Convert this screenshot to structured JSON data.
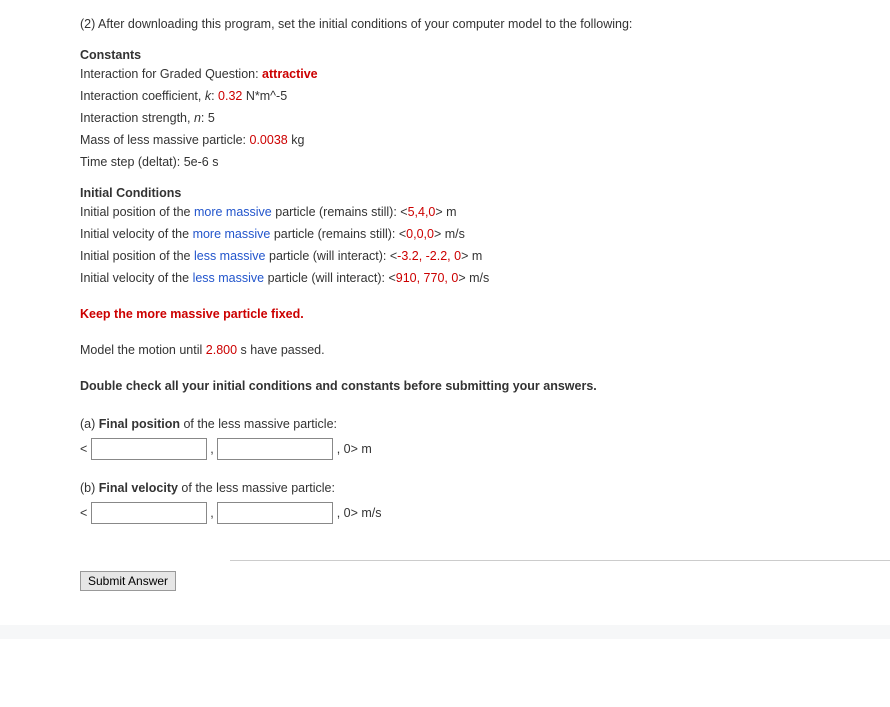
{
  "intro": "(2) After downloading this program, set the initial conditions of your computer model to the following:",
  "constants": {
    "heading": "Constants",
    "interaction_label": "Interaction for Graded Question: ",
    "interaction_value": "attractive",
    "coeff_label_pre": "Interaction coefficient, ",
    "coeff_symbol": "k",
    "coeff_label_colon": ": ",
    "coeff_value": "0.32",
    "coeff_unit": " N*m^-5",
    "strength_label_pre": "Interaction strength, ",
    "strength_symbol": "n",
    "strength_label_post": ": 5",
    "mass_label": "Mass of less massive particle: ",
    "mass_value": "0.0038",
    "mass_unit": " kg",
    "timestep": "Time step (deltat): 5e-6 s"
  },
  "initial": {
    "heading": "Initial Conditions",
    "pos_more_pre": "Initial position of the ",
    "more_massive": "more massive",
    "pos_more_post": " particle (remains still): <",
    "pos_more_val": "5,4,0",
    "pos_more_end": "> m",
    "vel_more_pre": "Initial velocity of the ",
    "vel_more_post": " particle (remains still): <",
    "vel_more_val": "0,0,0",
    "vel_more_end": "> m/s",
    "pos_less_pre": "Initial position of the ",
    "less_massive": "less massive",
    "pos_less_post": " particle (will interact): <",
    "pos_less_val": "-3.2, -2.2, 0",
    "pos_less_end": "> m",
    "vel_less_pre": "Initial velocity of the ",
    "vel_less_post": " particle (will interact): <",
    "vel_less_val": "910, 770, 0",
    "vel_less_end": "> m/s"
  },
  "keep_fixed": "Keep the more massive particle fixed.",
  "model_pre": "Model the motion until ",
  "model_time": "2.800",
  "model_post": " s have passed.",
  "double_check": "Double check all your initial conditions and constants before submitting your answers.",
  "part_a": {
    "label_pre": "(a) ",
    "label_bold": "Final position",
    "label_post": " of the less massive particle:",
    "open": "<",
    "comma": " , ",
    "close": " , 0> m"
  },
  "part_b": {
    "label_pre": "(b) ",
    "label_bold": "Final velocity",
    "label_post": " of the less massive particle:",
    "open": "<",
    "comma": " , ",
    "close": " , 0> m/s"
  },
  "submit": "Submit Answer"
}
